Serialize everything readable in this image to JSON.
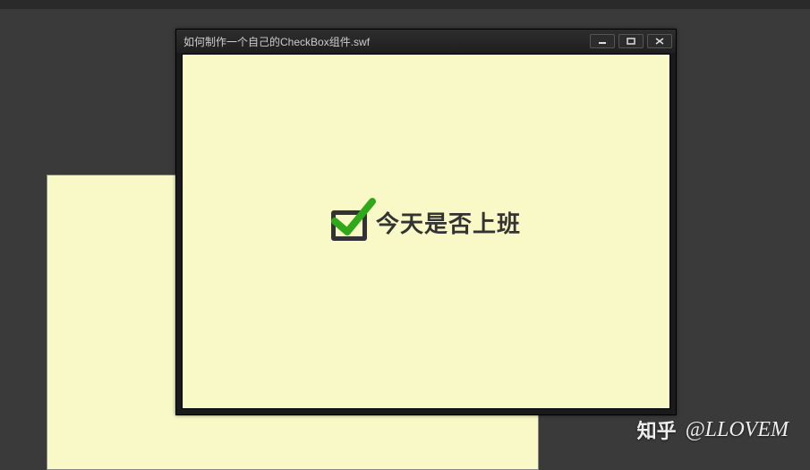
{
  "window": {
    "title": "如何制作一个自己的CheckBox组件.swf",
    "controls": {
      "minimize": "minimize-icon",
      "maximize": "maximize-icon",
      "close": "close-icon"
    }
  },
  "stage": {
    "checkbox": {
      "checked": true,
      "label": "今天是否上班",
      "tick_color": "#2fa81a",
      "box_color": "#333333"
    },
    "bg_color": "#f8f9c7"
  },
  "watermark": {
    "logo": "知乎",
    "handle": "@LLOVEM"
  }
}
